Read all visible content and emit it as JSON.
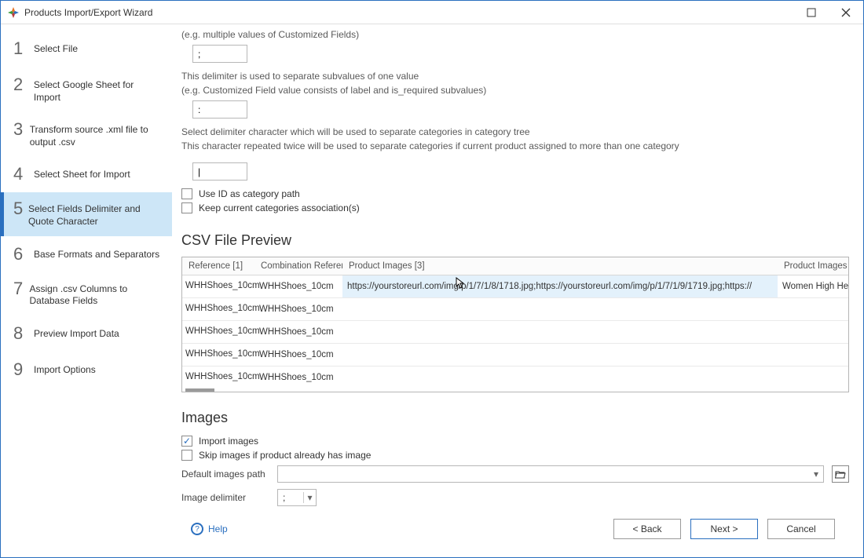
{
  "window": {
    "title": "Products Import/Export Wizard"
  },
  "steps": [
    {
      "n": "1",
      "label": "Select File"
    },
    {
      "n": "2",
      "label": "Select Google Sheet for Import"
    },
    {
      "n": "3",
      "label": "Transform source .xml file to output .csv"
    },
    {
      "n": "4",
      "label": "Select Sheet for Import"
    },
    {
      "n": "5",
      "label": "Select Fields Delimiter and Quote Character"
    },
    {
      "n": "6",
      "label": "Base Formats and Separators"
    },
    {
      "n": "7",
      "label": "Assign .csv Columns to Database Fields"
    },
    {
      "n": "8",
      "label": "Preview Import Data"
    },
    {
      "n": "9",
      "label": "Import Options"
    }
  ],
  "delimiter_section": {
    "eg_multi": "(e.g. multiple values of Customized Fields)",
    "input1": ";",
    "subvalue_line1": "This delimiter is used to separate subvalues of one value",
    "subvalue_line2": "(e.g. Customized Field value consists of label and is_required subvalues)",
    "input2": ":",
    "cat_line1": "Select delimiter character which will be used to separate categories in category tree",
    "cat_line2": "This character repeated twice will be used to separate categories if current product assigned to more than one category",
    "input3": "|",
    "chk_useid": "Use ID as category path",
    "chk_keep": "Keep current categories association(s)"
  },
  "preview": {
    "heading": "CSV File Preview",
    "columns": {
      "ref": "Reference [1]",
      "combref": "Combination Referen",
      "images": "Product Images [3]",
      "pi": "Product Images"
    },
    "rows": [
      {
        "ref1": "WHHShoes_10cm",
        "ref1b": "WHHShoes_10cm",
        "images": "https://yourstoreurl.com/img/p/1/7/1/8/1718.jpg;https://yourstoreurl.com/img/p/1/7/1/9/1719.jpg;https://",
        "pi": "Women High He"
      },
      {
        "ref1": "WHHShoes_10cm",
        "ref1b": "WHHShoes_10cm",
        "images": "",
        "pi": ""
      },
      {
        "ref1": "WHHShoes_10cm",
        "ref1b": "WHHShoes_10cm",
        "images": "",
        "pi": ""
      },
      {
        "ref1": "WHHShoes_10cm",
        "ref1b": "WHHShoes_10cm",
        "images": "",
        "pi": ""
      },
      {
        "ref1": "WHHShoes_10cm",
        "ref1b": "WHHShoes_10cm",
        "images": "",
        "pi": ""
      }
    ]
  },
  "images_section": {
    "heading": "Images",
    "chk_import": "Import images",
    "chk_skip": "Skip images if product already has image",
    "default_path_label": "Default images path",
    "default_path_value": "",
    "delimiter_label": "Image delimiter",
    "delimiter_value": ";"
  },
  "footer": {
    "help": "Help",
    "back": "< Back",
    "next": "Next >",
    "cancel": "Cancel"
  }
}
